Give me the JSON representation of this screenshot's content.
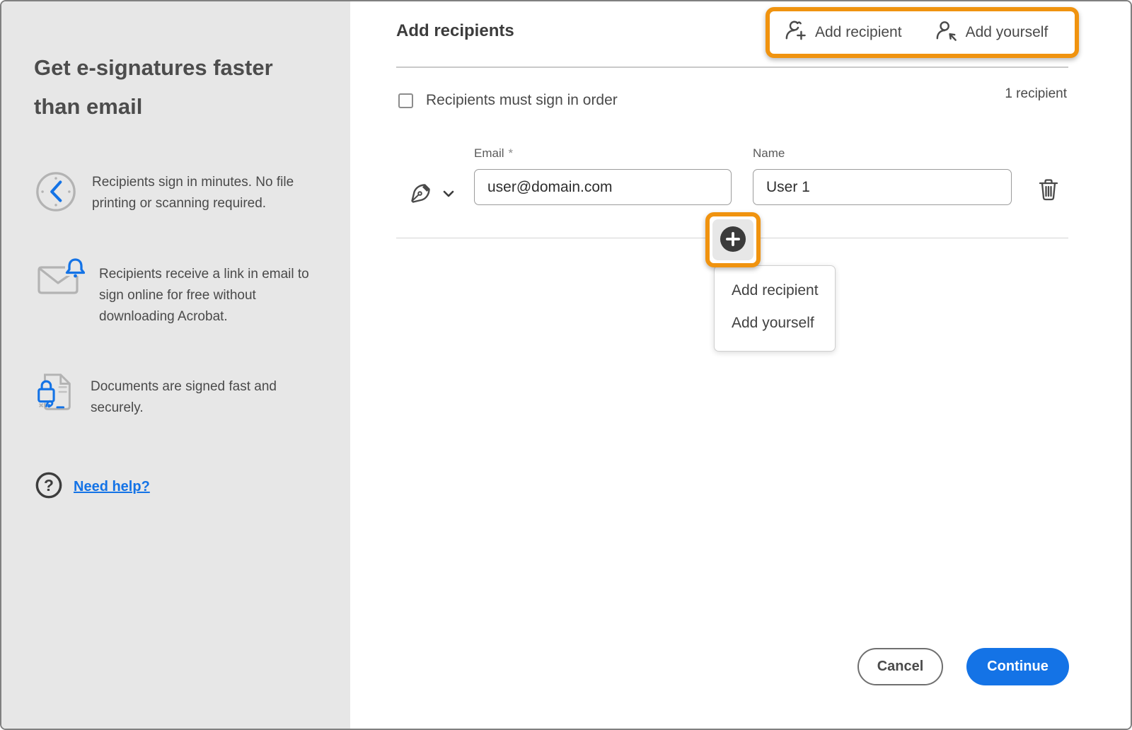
{
  "sidebar": {
    "title": "Get e-signatures faster\nthan email",
    "benefits": [
      {
        "icon": "clock-icon",
        "text": "Recipients sign in minutes. No file\nprinting or scanning required."
      },
      {
        "icon": "envelope-bell-icon",
        "text": "Recipients receive a link in email to\nsign online for free without\ndownloading Acrobat."
      },
      {
        "icon": "document-lock-icon",
        "text": "Documents are signed fast and\nsecurely."
      }
    ],
    "help_link": "Need help?"
  },
  "header": {
    "title": "Add recipients",
    "add_recipient_label": "Add recipient",
    "add_yourself_label": "Add yourself"
  },
  "options": {
    "sign_in_order_label": "Recipients must sign in order",
    "recipient_count": "1 recipient"
  },
  "recipient_form": {
    "email_label": "Email",
    "required_marker": "*",
    "email_value": "user@domain.com",
    "name_label": "Name",
    "name_value": "User 1"
  },
  "add_menu": {
    "items": [
      "Add recipient",
      "Add yourself"
    ]
  },
  "footer": {
    "cancel_label": "Cancel",
    "continue_label": "Continue"
  },
  "icons": {
    "top_bar": [
      "person-plus-icon",
      "person-arrow-icon"
    ],
    "row": [
      "pen-nib-icon",
      "chevron-down-icon",
      "trash-icon",
      "plus-circle-icon"
    ],
    "help": "question-circle-icon"
  },
  "colors": {
    "accent_blue": "#1473E6",
    "callout_orange": "#F0930F",
    "sidebar_bg": "#e7e7e7",
    "dark_circle": "#3b3b3b"
  }
}
